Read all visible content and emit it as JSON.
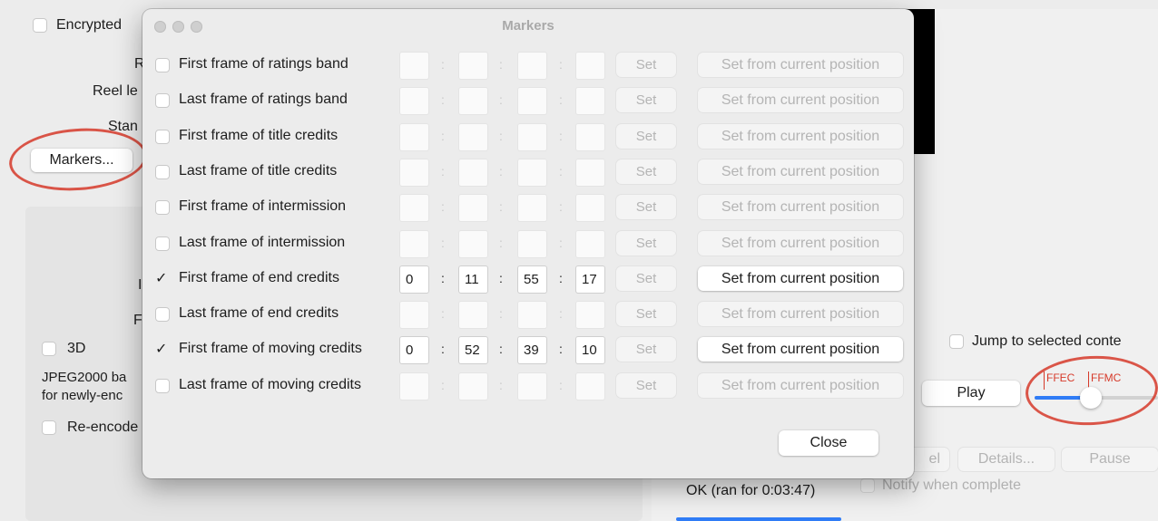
{
  "main_window": {
    "encrypted_label": "Encrypted",
    "left_labels": [
      "R",
      "Reel le",
      "Stan"
    ],
    "markers_button": "Markers...",
    "letter_p": "I",
    "letter_f": "F",
    "threed_label": "3D",
    "jpeg_line1": "JPEG2000 ba",
    "jpeg_line2": "for newly-enc",
    "reencode_label": "Re-encode",
    "jump_label": "Jump to selected conte",
    "play_button": "Play",
    "ffec_label": "FFEC",
    "ffmc_label": "FFMC",
    "cancel_partial": "el",
    "details_button": "Details...",
    "pause_button": "Pause",
    "status_text": "OK (ran for 0:03:47)",
    "notify_label": "Notify when complete",
    "annotation_color": "#d63a2a"
  },
  "dialog": {
    "title": "Markers",
    "set_label": "Set",
    "set_from_label": "Set from current position",
    "close_button": "Close",
    "rows": [
      {
        "label": "First frame of ratings band",
        "checked": false,
        "h": "",
        "m": "",
        "s": "",
        "f": ""
      },
      {
        "label": "Last frame of ratings band",
        "checked": false,
        "h": "",
        "m": "",
        "s": "",
        "f": ""
      },
      {
        "label": "First frame of title credits",
        "checked": false,
        "h": "",
        "m": "",
        "s": "",
        "f": ""
      },
      {
        "label": "Last frame of title credits",
        "checked": false,
        "h": "",
        "m": "",
        "s": "",
        "f": ""
      },
      {
        "label": "First frame of intermission",
        "checked": false,
        "h": "",
        "m": "",
        "s": "",
        "f": ""
      },
      {
        "label": "Last frame of intermission",
        "checked": false,
        "h": "",
        "m": "",
        "s": "",
        "f": ""
      },
      {
        "label": "First frame of end credits",
        "checked": true,
        "h": "0",
        "m": "11",
        "s": "55",
        "f": "17"
      },
      {
        "label": "Last frame of end credits",
        "checked": false,
        "h": "",
        "m": "",
        "s": "",
        "f": ""
      },
      {
        "label": "First frame of moving credits",
        "checked": true,
        "h": "0",
        "m": "52",
        "s": "39",
        "f": "10"
      },
      {
        "label": "Last frame of moving credits",
        "checked": false,
        "h": "",
        "m": "",
        "s": "",
        "f": ""
      }
    ]
  }
}
